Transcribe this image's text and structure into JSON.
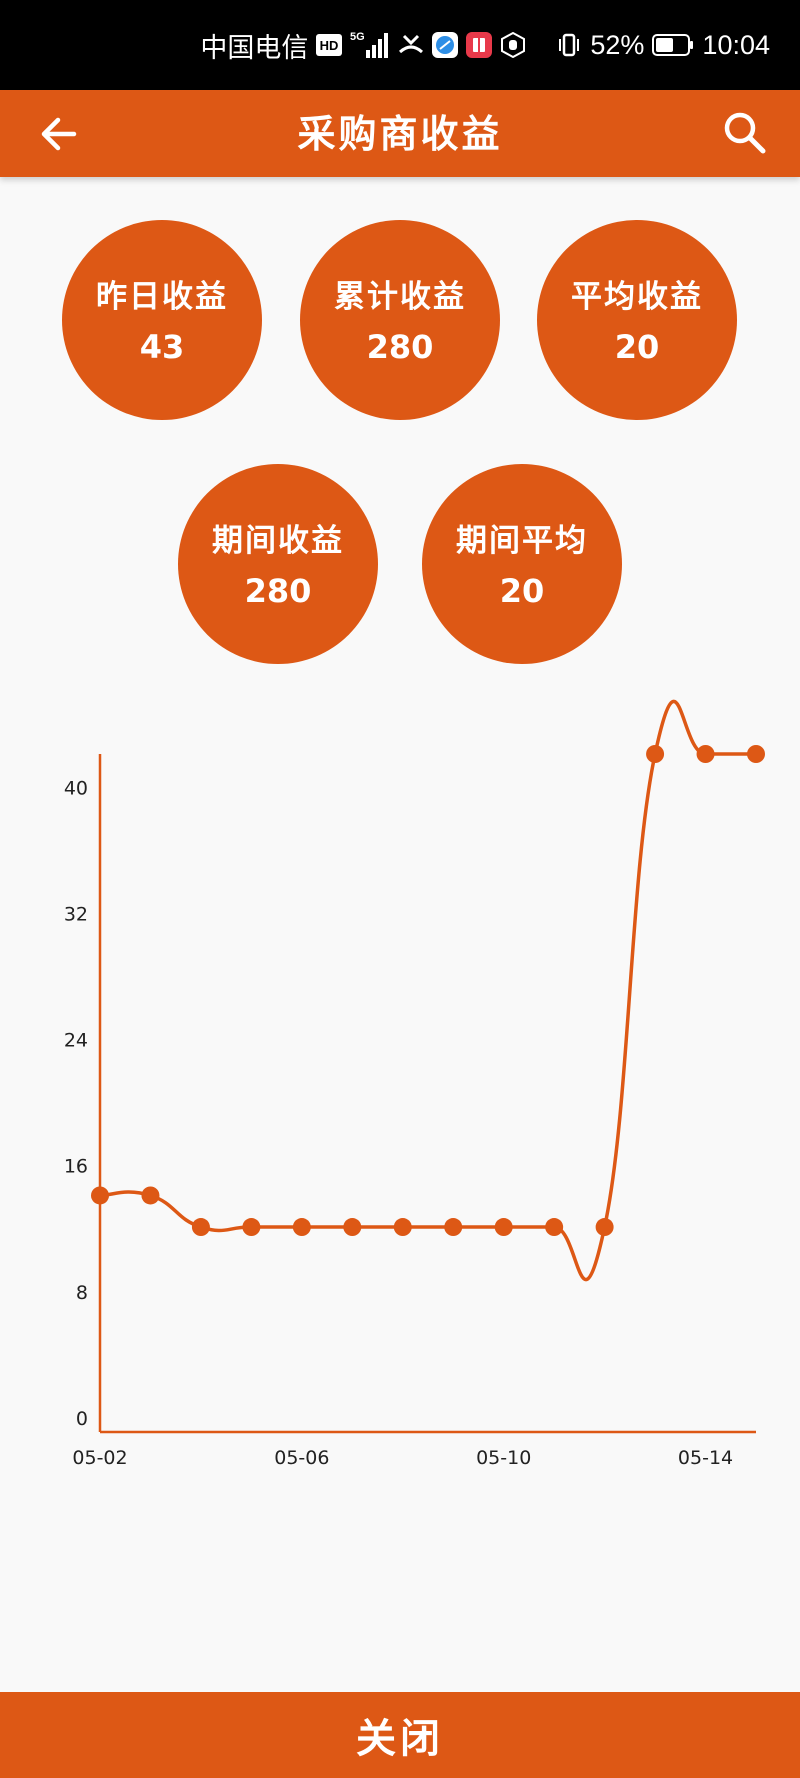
{
  "status_bar": {
    "carrier": "中国电信",
    "hd_badge": "HD",
    "network": "5G",
    "battery_percent": "52%",
    "time": "10:04",
    "icons": [
      "hd-icon",
      "signal-icon",
      "missed-call-icon",
      "browser-app-icon",
      "book-app-icon",
      "hand-app-icon",
      "vibrate-icon",
      "battery-icon"
    ]
  },
  "header": {
    "title": "采购商收益",
    "back_icon": "arrow-left-icon",
    "search_icon": "search-icon"
  },
  "stats": [
    {
      "label": "昨日收益",
      "value": "43"
    },
    {
      "label": "累计收益",
      "value": "280"
    },
    {
      "label": "平均收益",
      "value": "20"
    },
    {
      "label": "期间收益",
      "value": "280"
    },
    {
      "label": "期间平均",
      "value": "20"
    }
  ],
  "chart_data": {
    "type": "line",
    "smooth": true,
    "x": [
      "05-02",
      "05-03",
      "05-04",
      "05-05",
      "05-06",
      "05-07",
      "05-08",
      "05-09",
      "05-10",
      "05-11",
      "05-12",
      "05-13",
      "05-14",
      "05-15"
    ],
    "x_tick_labels": [
      "05-02",
      "05-06",
      "05-10",
      "05-14"
    ],
    "values": [
      15,
      15,
      13,
      13,
      13,
      13,
      13,
      13,
      13,
      13,
      13,
      43,
      43,
      43
    ],
    "ylim": [
      0,
      43
    ],
    "y_ticks": [
      0,
      8,
      16,
      24,
      32,
      40
    ],
    "grid": false,
    "legend": "none",
    "color": "#dd5815"
  },
  "footer": {
    "close_label": "关闭"
  },
  "colors": {
    "accent": "#dd5815",
    "status_bar_bg": "#000000",
    "background": "#f9f9f9"
  }
}
